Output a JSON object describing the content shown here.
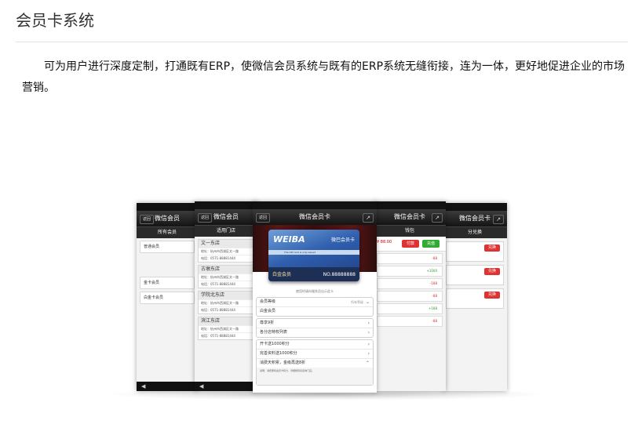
{
  "page": {
    "title": "会员卡系统",
    "intro": "可为用户进行深度定制，打通既有ERP，使微信会员系统与既有的ERP系统无缝衔接，连为一体，更好地促进企业的市场营销。"
  },
  "phones": {
    "p1": {
      "back": "返回",
      "title": "微信会员",
      "subtitle": "所有会员",
      "rows": [
        "普通会员",
        "金卡会员",
        "白金卡会员"
      ]
    },
    "p2": {
      "back": "返回",
      "title": "微信会员",
      "subtitle": "适用门店",
      "shops": [
        "文一东店",
        "古墩东店",
        "学院北东店",
        "滨江东店"
      ],
      "addr": "地址：杭州市西湖区文一路",
      "tel": "电话：0571-88881444"
    },
    "main": {
      "back": "返回",
      "title": "微信会员卡",
      "card": {
        "logo": "WEIBA",
        "name": "微巴会员卡",
        "stripe": "The VIP card is only issued",
        "level": "白金会员",
        "number": "NO.88888888"
      },
      "hint": "使用时请向服务员出示此卡",
      "group1": {
        "label": "会员等级",
        "right": "所有等级",
        "item": "白金会员"
      },
      "group2": [
        "尊享9折",
        "各分店特权列表"
      ],
      "group3": [
        "开卡送1000积分",
        "完善资料送1000积分",
        "消费天积累，金级再送8折"
      ],
      "detail": "说明：消费累积会员卡积分，详细规则请咨询门店。"
    },
    "p4": {
      "title": "微信会员卡",
      "subtitle": "钱包",
      "price": "¥ 88.00",
      "pay": "付款",
      "recharge": "充值",
      "records": [
        "-88",
        "+1000",
        "-188",
        "-88",
        "+188",
        "-88"
      ]
    },
    "p5": {
      "title": "微信会员卡",
      "subtitle": "分兑换",
      "exchange": [
        "兑换",
        "兑换",
        "兑换"
      ]
    }
  }
}
